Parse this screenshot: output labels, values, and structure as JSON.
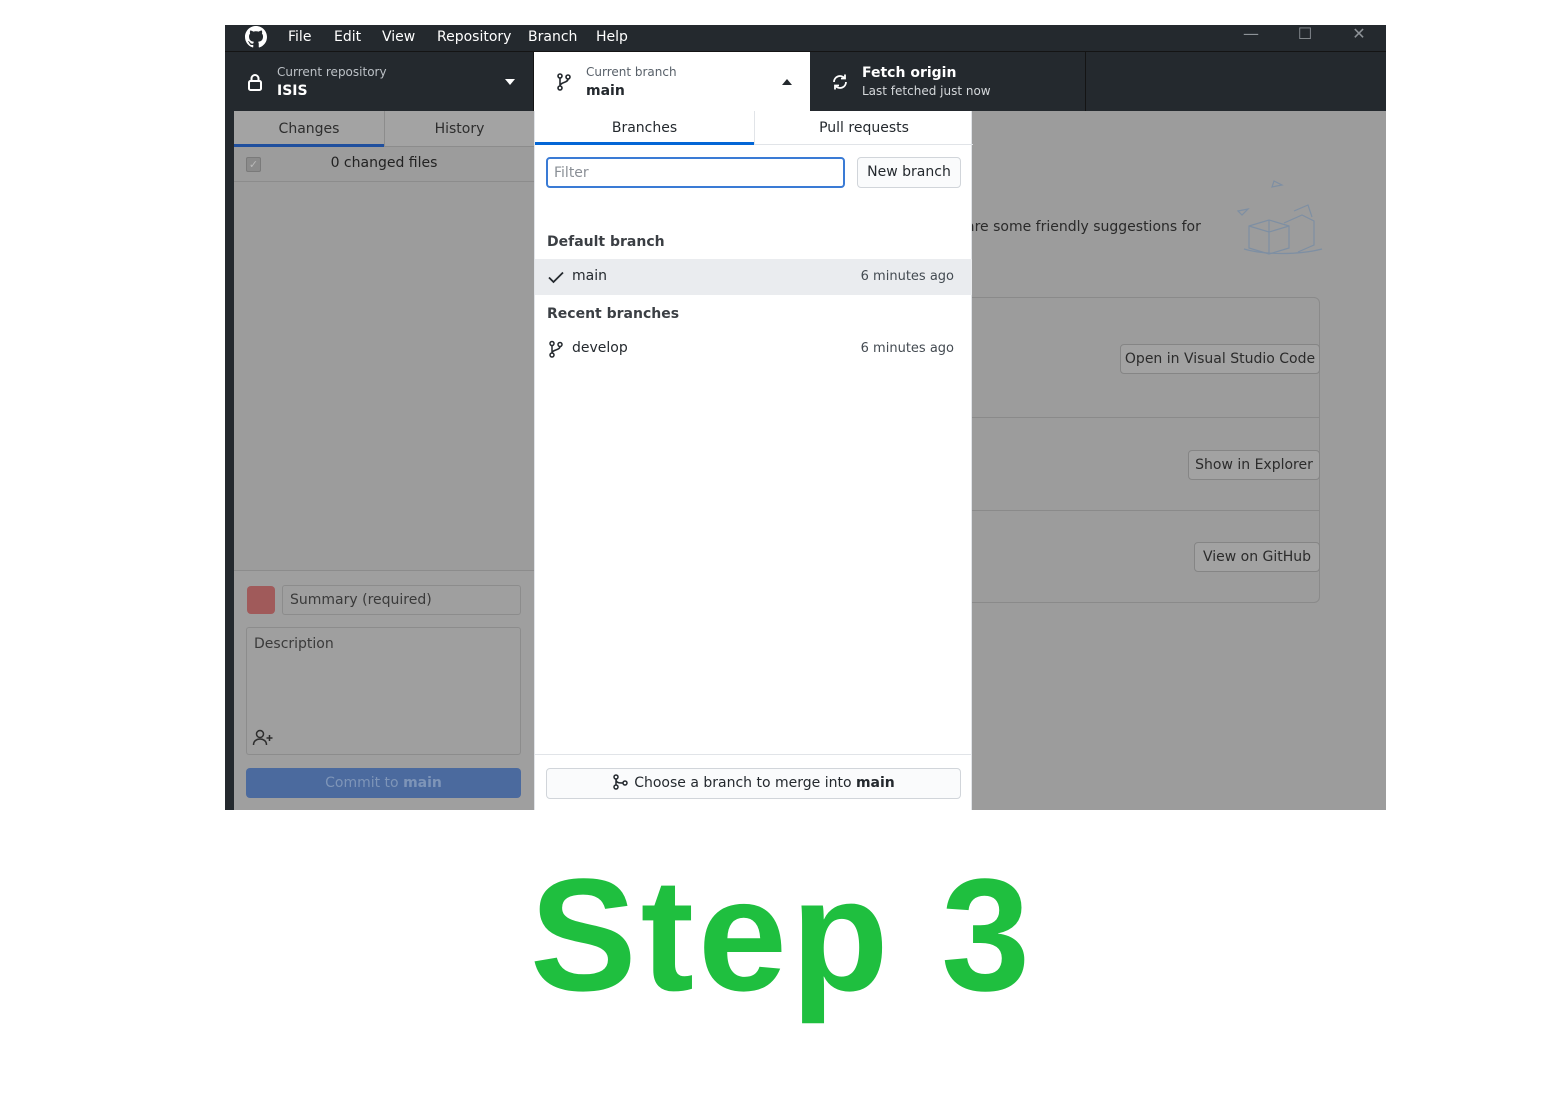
{
  "menu": {
    "items": [
      "File",
      "Edit",
      "View",
      "Repository",
      "Branch",
      "Help"
    ]
  },
  "window_controls": {
    "minimize": "—",
    "maximize": "☐",
    "close": "✕"
  },
  "toolbar": {
    "repository": {
      "label": "Current repository",
      "value": "ISIS",
      "icon": "lock-icon"
    },
    "branch": {
      "label": "Current branch",
      "value": "main",
      "icon": "git-branch-icon"
    },
    "fetch": {
      "label": "Fetch origin",
      "sublabel": "Last fetched just now",
      "icon": "sync-icon"
    }
  },
  "sidebar": {
    "tabs": [
      "Changes",
      "History"
    ],
    "changed_files": "0 changed files",
    "summary_placeholder": "Summary (required)",
    "description_placeholder": "Description",
    "commit_button": {
      "prefix": "Commit to ",
      "branch": "main"
    }
  },
  "main": {
    "suggestion_text": "are some friendly suggestions for",
    "actions": [
      "Open in Visual Studio Code",
      "Show in Explorer",
      "View on GitHub"
    ]
  },
  "dropdown": {
    "tabs": [
      "Branches",
      "Pull requests"
    ],
    "filter_placeholder": "Filter",
    "new_branch": "New branch",
    "default_heading": "Default branch",
    "recent_heading": "Recent branches",
    "default_branches": [
      {
        "name": "main",
        "time": "6 minutes ago",
        "icon": "check-icon"
      }
    ],
    "recent_branches": [
      {
        "name": "develop",
        "time": "6 minutes ago",
        "icon": "git-branch-icon"
      }
    ],
    "merge_button": {
      "prefix": "Choose a branch to merge into ",
      "branch": "main"
    }
  },
  "caption": "Step 3",
  "colors": {
    "caption": "#1fbf3f",
    "accent": "#0366d6",
    "titlebar": "#24292e"
  }
}
